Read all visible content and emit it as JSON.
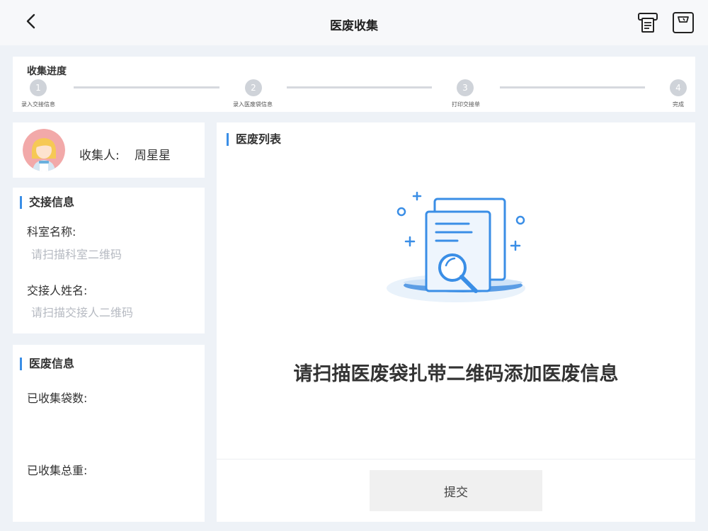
{
  "header": {
    "title": "医废收集",
    "back_icon": "chevron-left-icon",
    "printer_icon": "printer-icon",
    "scale_icon": "scale-icon"
  },
  "progress": {
    "title": "收集进度",
    "current_step": 0,
    "steps": [
      {
        "number": "1",
        "label": "录入交接信息"
      },
      {
        "number": "2",
        "label": "录入医废袋信息"
      },
      {
        "number": "3",
        "label": "打印交接单"
      },
      {
        "number": "4",
        "label": "完成"
      }
    ]
  },
  "collector": {
    "label": "收集人:",
    "name": "周星星"
  },
  "handover": {
    "title": "交接信息",
    "department_label": "科室名称:",
    "department_placeholder": "请扫描科室二维码",
    "person_label": "交接人姓名:",
    "person_placeholder": "请扫描交接人二维码"
  },
  "waste_info": {
    "title": "医废信息",
    "bags_label": "已收集袋数:",
    "weight_label": "已收集总重:"
  },
  "waste_list": {
    "title": "医废列表",
    "empty_message": "请扫描医废袋扎带二维码添加医废信息",
    "submit_label": "提交"
  },
  "colors": {
    "accent": "#3a8ee6",
    "step_inactive": "#cfd3d9",
    "placeholder": "#b6bac2",
    "background": "#eef2f7"
  }
}
